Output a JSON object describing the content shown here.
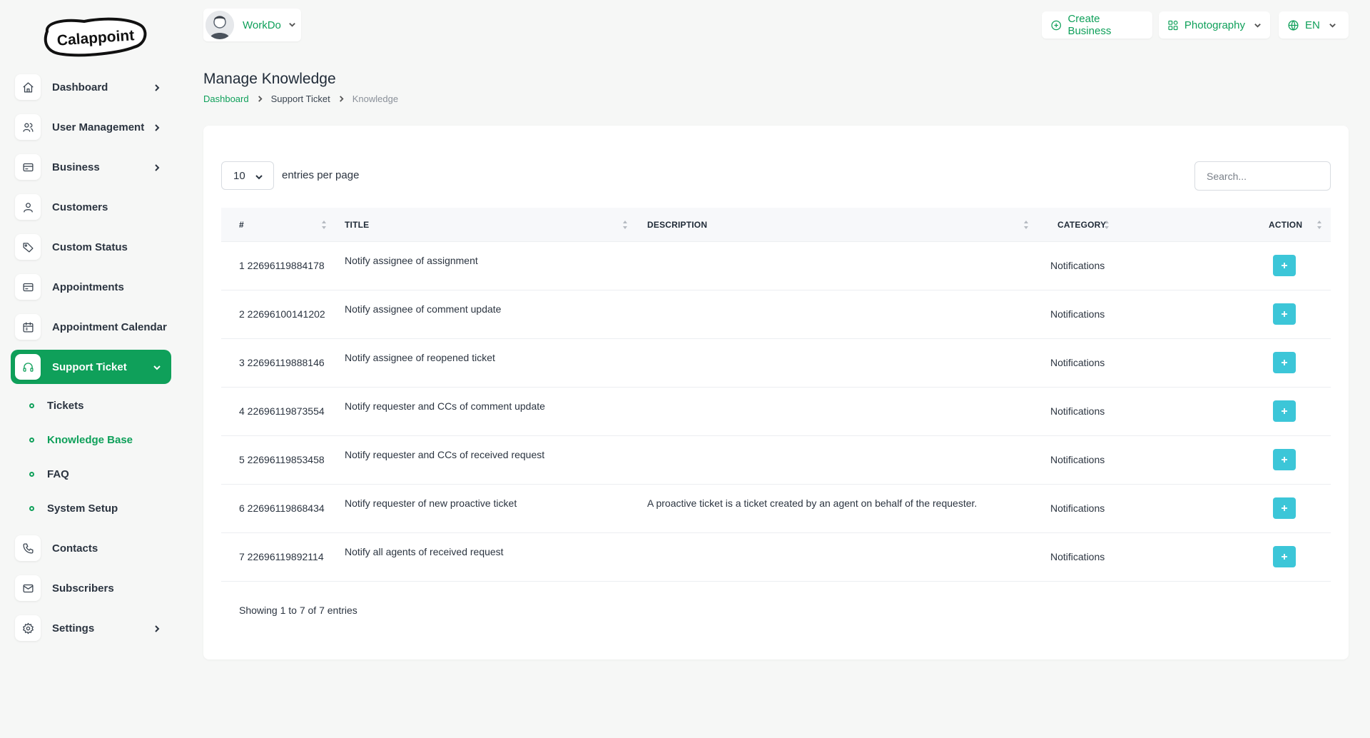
{
  "brand": {
    "logo_text": "Calappoint"
  },
  "sidebar": {
    "items": [
      {
        "label": "Dashboard",
        "icon": "home-icon",
        "has_chevron": true
      },
      {
        "label": "User Management",
        "icon": "users-icon",
        "has_chevron": true
      },
      {
        "label": "Business",
        "icon": "card-icon",
        "has_chevron": true
      },
      {
        "label": "Customers",
        "icon": "user-icon",
        "has_chevron": false
      },
      {
        "label": "Custom Status",
        "icon": "tag-icon",
        "has_chevron": false
      },
      {
        "label": "Appointments",
        "icon": "card-icon",
        "has_chevron": false
      },
      {
        "label": "Appointment Calendar",
        "icon": "calendar-icon",
        "has_chevron": false
      },
      {
        "label": "Support Ticket",
        "icon": "headphones-icon",
        "has_chevron": true,
        "active": true
      }
    ],
    "sub_items": [
      {
        "label": "Tickets"
      },
      {
        "label": "Knowledge Base",
        "active": true
      },
      {
        "label": "FAQ"
      },
      {
        "label": "System Setup"
      }
    ],
    "items_after": [
      {
        "label": "Contacts",
        "icon": "phone-icon",
        "has_chevron": false
      },
      {
        "label": "Subscribers",
        "icon": "mail-icon",
        "has_chevron": false
      },
      {
        "label": "Settings",
        "icon": "gear-icon",
        "has_chevron": true
      }
    ]
  },
  "header": {
    "org_name": "WorkDo",
    "create_business": "Create Business",
    "business_select": "Photography",
    "language": "EN"
  },
  "page": {
    "title": "Manage Knowledge",
    "breadcrumb": [
      "Dashboard",
      "Support Ticket",
      "Knowledge"
    ]
  },
  "table": {
    "per_page_value": "10",
    "per_page_label": "entries per page",
    "search_placeholder": "Search...",
    "columns": [
      "#",
      "TITLE",
      "DESCRIPTION",
      "CATEGORY",
      "ACTION"
    ],
    "rows": [
      {
        "num": "1 22696119884178",
        "title": "Notify assignee of assignment",
        "description": "",
        "category": "Notifications"
      },
      {
        "num": "2 22696100141202",
        "title": "Notify assignee of comment update",
        "description": "",
        "category": "Notifications"
      },
      {
        "num": "3 22696119888146",
        "title": "Notify assignee of reopened ticket",
        "description": "",
        "category": "Notifications"
      },
      {
        "num": "4 22696119873554",
        "title": "Notify requester and CCs of comment update",
        "description": "",
        "category": "Notifications"
      },
      {
        "num": "5 22696119853458",
        "title": "Notify requester and CCs of received request",
        "description": "",
        "category": "Notifications"
      },
      {
        "num": "6 22696119868434",
        "title": "Notify requester of new proactive ticket",
        "description": "A proactive ticket is a ticket created by an agent on behalf of the requester.",
        "category": "Notifications"
      },
      {
        "num": "7 22696119892114",
        "title": "Notify all agents of received request",
        "description": "",
        "category": "Notifications"
      }
    ],
    "showing": "Showing 1 to 7 of 7 entries"
  },
  "colors": {
    "accent": "#0fa05a",
    "action_button": "#3cc6d8",
    "background": "#f6f7f6"
  }
}
